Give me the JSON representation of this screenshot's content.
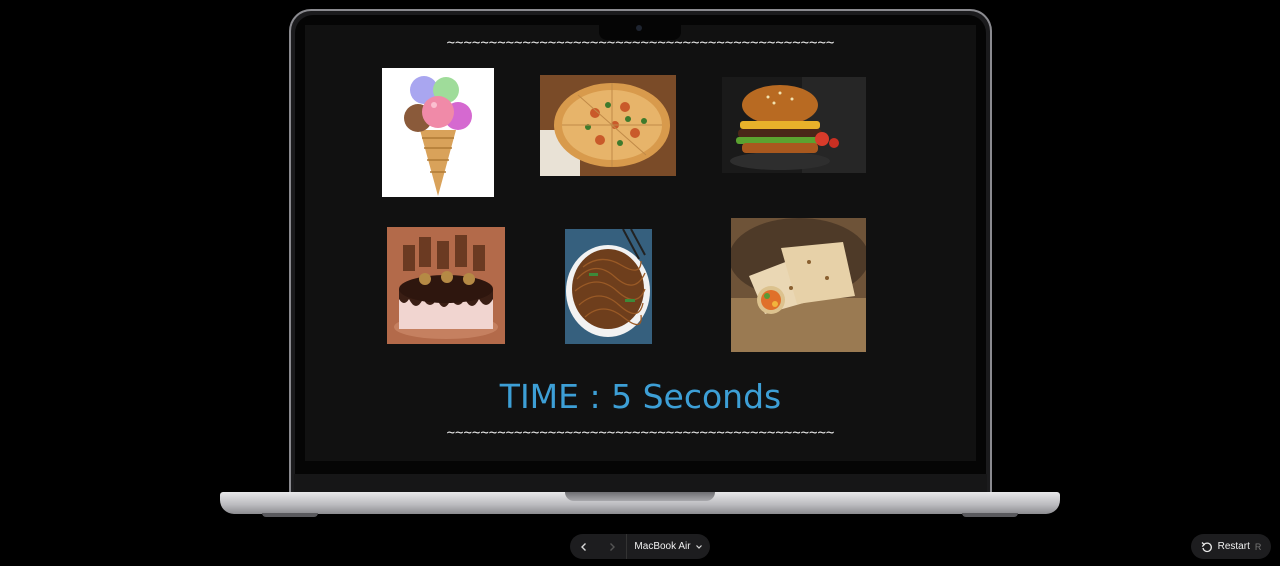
{
  "screen": {
    "decor_top": "~~~~~~~~~~~~~~~~~~~~~~~~~~~~~~~~~~~~~~~~~~~~~~",
    "decor_bottom": "~~~~~~~~~~~~~~~~~~~~~~~~~~~~~~~~~~~~~~~~~~~~~~",
    "timer_text": "TIME : 5 Seconds",
    "foods": [
      "ice-cream",
      "pizza",
      "burger",
      "cake",
      "noodles",
      "wrap"
    ]
  },
  "controls": {
    "back_icon": "chevron-left-icon",
    "forward_icon": "chevron-right-icon",
    "device_label": "MacBook Air",
    "device_chevron": "⌄",
    "restart_label": "Restart",
    "restart_shortcut": "R"
  },
  "colors": {
    "timer": "#3d9fd6",
    "screen_bg": "#111111"
  }
}
